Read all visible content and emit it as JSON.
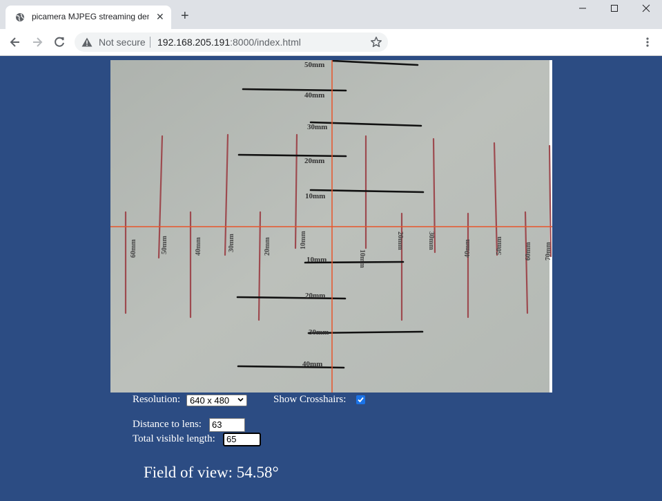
{
  "browser": {
    "tab_title": "picamera MJPEG streaming demo",
    "security_label": "Not secure",
    "url_host": "192.168.205.191",
    "url_rest": ":8000/index.html"
  },
  "controls": {
    "resolution_label": "Resolution:",
    "resolution_value": "640 x 480",
    "crosshairs_label": "Show Crosshairs:",
    "crosshairs_checked": true,
    "distance_label": "Distance to lens:",
    "distance_value": "63",
    "length_label": "Total visible length:",
    "length_value": "65",
    "fov_text": "Field of view: 54.58°"
  },
  "stream": {
    "vertical_scale_labels": [
      "50mm",
      "40mm",
      "30mm",
      "20mm",
      "10mm",
      "10mm",
      "20mm",
      "30mm",
      "40mm"
    ],
    "horizontal_scale_labels": [
      "60mm",
      "50mm",
      "40mm",
      "30mm",
      "20mm",
      "10mm",
      "10mm",
      "20mm",
      "30mm",
      "40mm",
      "50mm",
      "60mm",
      "70mm"
    ]
  },
  "colors": {
    "page_background": "#2c4c83",
    "crosshair": "#e8552a",
    "checkbox": "#1a73e8"
  },
  "icons": [
    "globe-icon",
    "close-icon",
    "plus-icon",
    "minimize-icon",
    "maximize-icon",
    "window-close-icon",
    "back-arrow-icon",
    "forward-arrow-icon",
    "reload-icon",
    "warning-icon",
    "star-icon",
    "more-vert-icon",
    "chevron-down-icon",
    "checkmark-icon"
  ]
}
